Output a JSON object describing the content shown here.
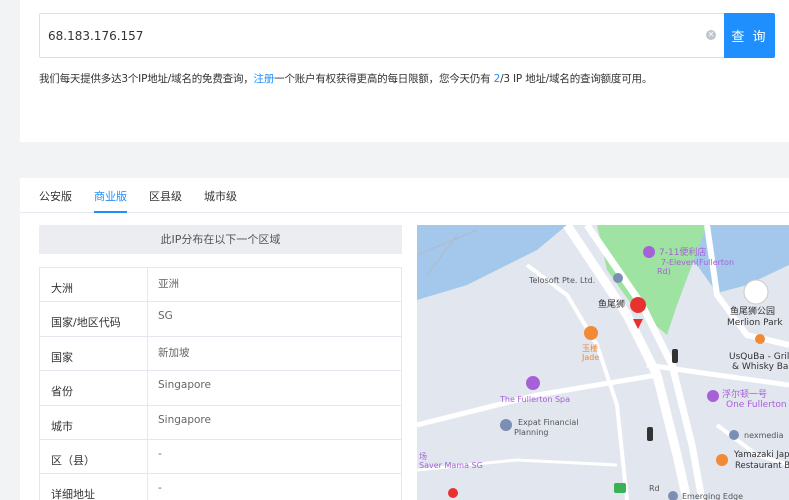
{
  "search": {
    "value": "68.183.176.157",
    "button_label": "查 询"
  },
  "quota": {
    "prefix": "我们每天提供多达3个IP地址/域名的免费查询，",
    "register_link": "注册",
    "middle": "一个账户有权获得更高的每日限额，您今天仍有 ",
    "remaining": "2",
    "suffix": "/3 IP 地址/域名的查询额度可用。"
  },
  "tabs": [
    {
      "label": "公安版",
      "active": false
    },
    {
      "label": "商业版",
      "active": true
    },
    {
      "label": "区县级",
      "active": false
    },
    {
      "label": "城市级",
      "active": false
    }
  ],
  "distribution_header": "此IP分布在以下一个区域",
  "info_rows": [
    {
      "key": "大洲",
      "value": "亚洲"
    },
    {
      "key": "国家/地区代码",
      "value": "SG"
    },
    {
      "key": "国家",
      "value": "新加坡"
    },
    {
      "key": "省份",
      "value": "Singapore"
    },
    {
      "key": "城市",
      "value": "Singapore"
    },
    {
      "key": "区（县）",
      "value": "-"
    },
    {
      "key": "详细地址",
      "value": "-"
    }
  ],
  "map": {
    "labels": {
      "eleven_1": "7-11便利店",
      "eleven_2": "7-Eleven(Fullerton",
      "eleven_3": "Rd)",
      "telosoft": "Telosoft Pte. Ltd.",
      "merlion_cn": "鱼尾狮",
      "merlion_park_cn": "鱼尾狮公园",
      "merlion_park_en": "Merlion Park",
      "yulou_1": "玉楼",
      "yulou_2": "Jade",
      "usquba_1": "UsQuBa - Grill",
      "usquba_2": "& Whisky Bar",
      "one_fullerton_cn": "浮尔顿一号",
      "one_fullerton_en": "One Fullerton",
      "fullerton_spa": "The Fullerton Spa",
      "expat_1": "Expat Financial",
      "expat_2": "Planning",
      "nexmedia": "nexmedia",
      "yamazaki_1": "Yamazaki Japa",
      "yamazaki_2": "Restaurant B",
      "saver_1": "场",
      "saver_2": "Saver Mama SG",
      "fullerton_rd": "Rd",
      "emerging_edge": "Emerging Edge"
    },
    "water_color": "#a4c8ec",
    "park_color": "#9ee3a2",
    "pin_color": "#e8322f"
  }
}
